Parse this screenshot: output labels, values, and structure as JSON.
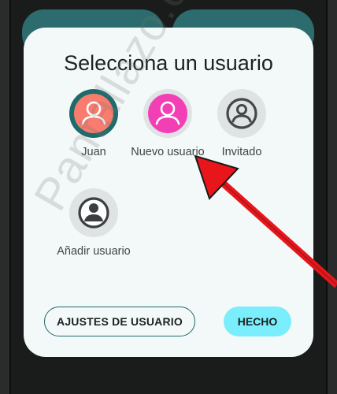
{
  "dialog": {
    "title": "Selecciona un usuario",
    "users": [
      {
        "name": "Juan",
        "avatar": "person-icon",
        "selected": true,
        "color": "#f97c6e"
      },
      {
        "name": "Nuevo usuario",
        "avatar": "person-icon",
        "selected": false,
        "color": "#f23fb5"
      },
      {
        "name": "Invitado",
        "avatar": "person-outline-icon",
        "selected": false,
        "color": "#444849"
      },
      {
        "name": "Añadir usuario",
        "avatar": "person-add-icon",
        "selected": false,
        "color": "#3b3f40"
      }
    ],
    "buttons": {
      "settings_label": "AJUSTES DE USUARIO",
      "done_label": "HECHO"
    }
  },
  "watermark": "Pantallazo.es",
  "colors": {
    "accent": "#1f6b6c",
    "done_button": "#7aeefc",
    "arrow": "#e8161b",
    "dialog_bg": "#f3f8f9"
  }
}
